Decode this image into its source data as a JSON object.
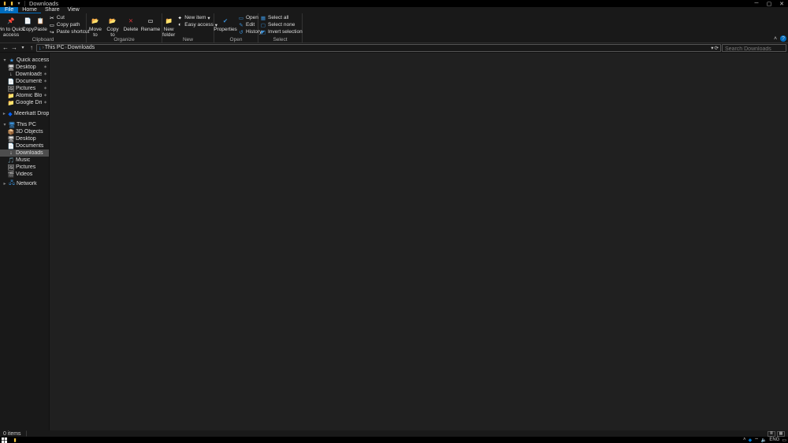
{
  "window": {
    "title": "Downloads",
    "qat_dropdown": "▾"
  },
  "win_controls": {
    "minimize": "─",
    "maximize": "▢",
    "close": "✕"
  },
  "tabs": {
    "file": "File",
    "home": "Home",
    "share": "Share",
    "view": "View"
  },
  "ribbon": {
    "clipboard": {
      "pin": "Pin to Quick\naccess",
      "copy": "Copy",
      "paste": "Paste",
      "cut": "Cut",
      "copypath": "Copy path",
      "pasteshortcut": "Paste shortcut",
      "label": "Clipboard"
    },
    "organize": {
      "moveto": "Move\nto",
      "copyto": "Copy\nto",
      "delete": "Delete",
      "rename": "Rename",
      "label": "Organize"
    },
    "new": {
      "newfolder": "New\nfolder",
      "newitem": "New item",
      "easy": "Easy access",
      "label": "New"
    },
    "open": {
      "properties": "Properties",
      "open": "Open",
      "edit": "Edit",
      "history": "History",
      "label": "Open"
    },
    "select": {
      "selectall": "Select all",
      "selectnone": "Select none",
      "invert": "Invert selection",
      "label": "Select"
    }
  },
  "addr": {
    "back": "←",
    "forward": "→",
    "recent": "▾",
    "up": "↑",
    "crumbs": [
      "This PC",
      "Downloads"
    ],
    "refresh": "⟳",
    "dropdown": "▾",
    "search_placeholder": "Search Downloads"
  },
  "tree": {
    "quick": "Quick access",
    "quick_items": [
      {
        "icon": "🖥",
        "label": "Desktop"
      },
      {
        "icon": "↓",
        "label": "Downloads"
      },
      {
        "icon": "📄",
        "label": "Documents"
      },
      {
        "icon": "🖼",
        "label": "Pictures"
      },
      {
        "icon": "📁",
        "label": "Atomic Blonde ("
      },
      {
        "icon": "📁",
        "label": "Google Drive"
      }
    ],
    "dropbox": "Meerkatt Dropbox",
    "thispc": "This PC",
    "pc_items": [
      {
        "icon": "📦",
        "label": "3D Objects"
      },
      {
        "icon": "🖥",
        "label": "Desktop"
      },
      {
        "icon": "📄",
        "label": "Documents"
      },
      {
        "icon": "↓",
        "label": "Downloads",
        "selected": true
      },
      {
        "icon": "🎵",
        "label": "Music"
      },
      {
        "icon": "🖼",
        "label": "Pictures"
      },
      {
        "icon": "🎬",
        "label": "Videos"
      }
    ],
    "network": "Network"
  },
  "status": {
    "items": "0 items"
  },
  "taskbar": {
    "lang": "ENG"
  }
}
